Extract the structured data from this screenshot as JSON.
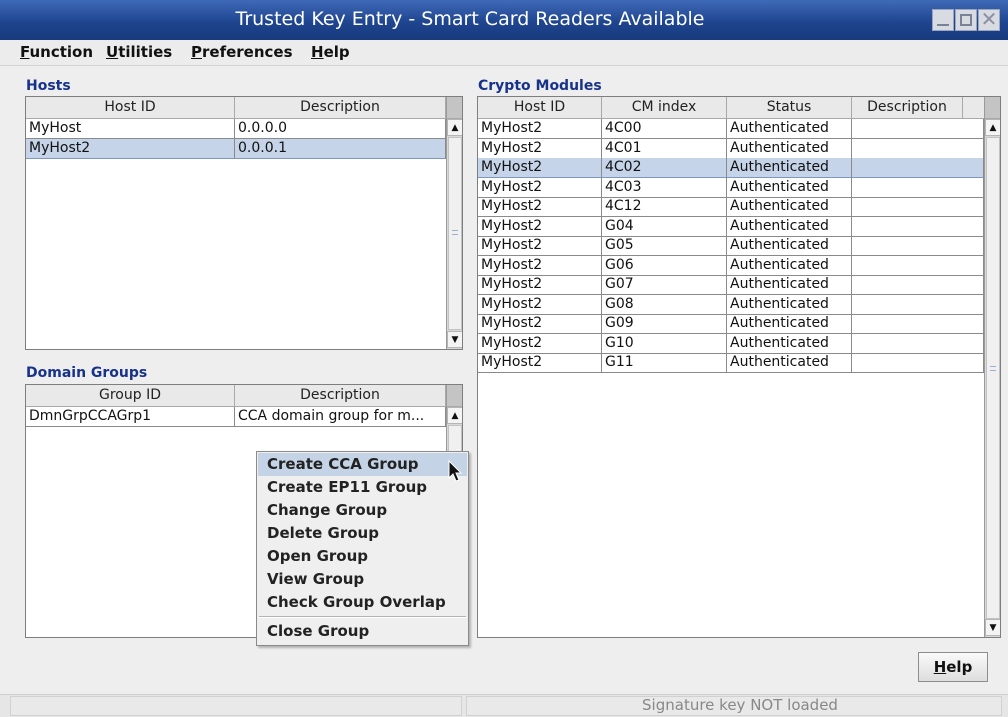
{
  "window": {
    "title": "Trusted Key Entry  - Smart Card Readers Available",
    "close_glyph": "✕"
  },
  "menubar": [
    {
      "mnemonic": "F",
      "rest": "unction"
    },
    {
      "mnemonic": "U",
      "rest": "tilities"
    },
    {
      "mnemonic": "P",
      "rest": "references"
    },
    {
      "mnemonic": "H",
      "rest": "elp"
    }
  ],
  "hosts": {
    "title": "Hosts",
    "columns": [
      "Host ID",
      "Description"
    ],
    "rows": [
      {
        "cells": [
          "MyHost",
          "0.0.0.0"
        ],
        "selected": false
      },
      {
        "cells": [
          "MyHost2",
          "0.0.0.1"
        ],
        "selected": true
      }
    ]
  },
  "domain_groups": {
    "title": "Domain Groups",
    "columns": [
      "Group ID",
      "Description"
    ],
    "rows": [
      {
        "cells": [
          "DmnGrpCCAGrp1",
          "CCA domain group for m..."
        ],
        "selected": false
      }
    ]
  },
  "crypto_modules": {
    "title": "Crypto Modules",
    "columns": [
      "Host ID",
      "CM index",
      "Status",
      "Description"
    ],
    "rows": [
      {
        "cells": [
          "MyHost2",
          "4C00",
          "Authenticated",
          ""
        ],
        "selected": false
      },
      {
        "cells": [
          "MyHost2",
          "4C01",
          "Authenticated",
          ""
        ],
        "selected": false
      },
      {
        "cells": [
          "MyHost2",
          "4C02",
          "Authenticated",
          ""
        ],
        "selected": true
      },
      {
        "cells": [
          "MyHost2",
          "4C03",
          "Authenticated",
          ""
        ],
        "selected": false
      },
      {
        "cells": [
          "MyHost2",
          "4C12",
          "Authenticated",
          ""
        ],
        "selected": false
      },
      {
        "cells": [
          "MyHost2",
          "G04",
          "Authenticated",
          ""
        ],
        "selected": false
      },
      {
        "cells": [
          "MyHost2",
          "G05",
          "Authenticated",
          ""
        ],
        "selected": false
      },
      {
        "cells": [
          "MyHost2",
          "G06",
          "Authenticated",
          ""
        ],
        "selected": false
      },
      {
        "cells": [
          "MyHost2",
          "G07",
          "Authenticated",
          ""
        ],
        "selected": false
      },
      {
        "cells": [
          "MyHost2",
          "G08",
          "Authenticated",
          ""
        ],
        "selected": false
      },
      {
        "cells": [
          "MyHost2",
          "G09",
          "Authenticated",
          ""
        ],
        "selected": false
      },
      {
        "cells": [
          "MyHost2",
          "G10",
          "Authenticated",
          ""
        ],
        "selected": false
      },
      {
        "cells": [
          "MyHost2",
          "G11",
          "Authenticated",
          ""
        ],
        "selected": false
      }
    ]
  },
  "context_menu": {
    "items": [
      "Create CCA Group",
      "Create EP11 Group",
      "Change Group",
      "Delete Group",
      "Open Group",
      "View Group",
      "Check Group Overlap"
    ],
    "highlighted": "Create CCA Group",
    "after_separator": "Close Group"
  },
  "help_button": {
    "mnemonic": "H",
    "rest": "elp"
  },
  "status": {
    "text": "Signature key NOT loaded"
  },
  "colors": {
    "accent": "#17328b",
    "selection": "#c5d4e8",
    "titlebar": "#1f4590"
  },
  "icons": {
    "up_arrow": "▲",
    "down_arrow": "▼"
  }
}
